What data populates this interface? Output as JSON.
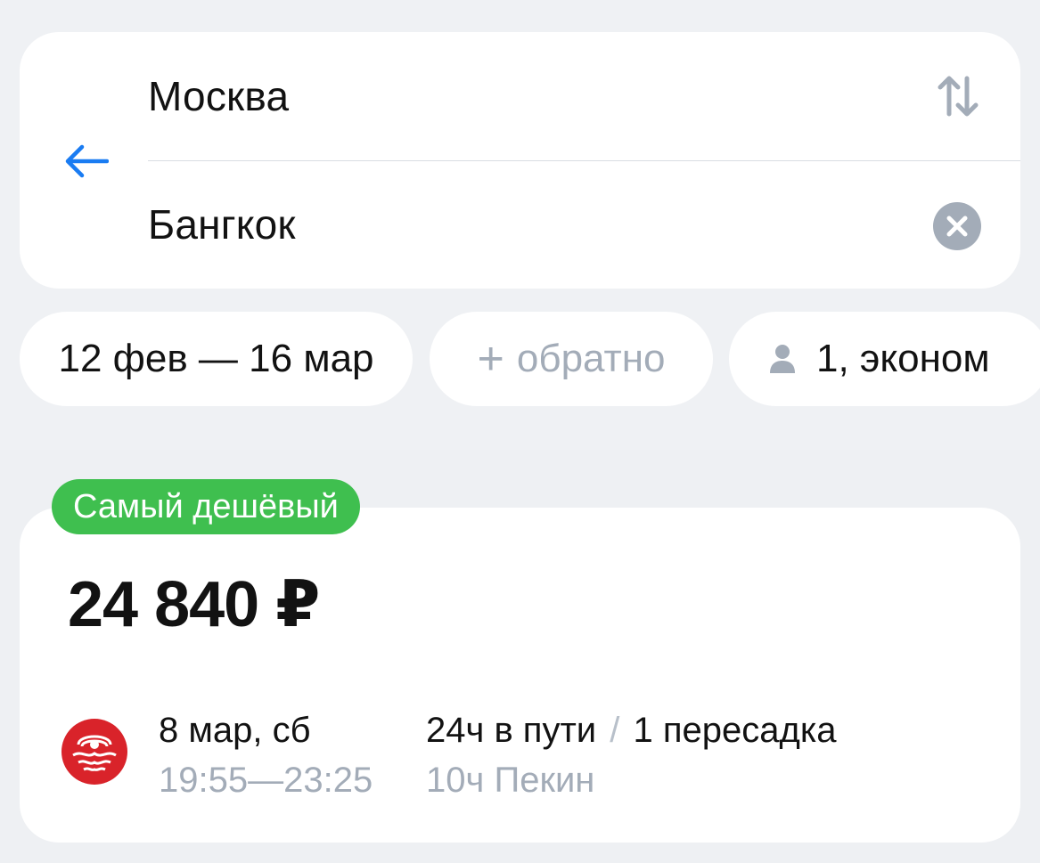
{
  "search": {
    "origin": "Москва",
    "destination": "Бангкок",
    "icons": {
      "back": "arrow-left-icon",
      "swap": "swap-vertical-icon",
      "clear": "clear-circle-icon"
    }
  },
  "filters": {
    "dates": "12 фев — 16 мар",
    "return_plus": "+",
    "return_label": "обратно",
    "passengers": "1, эконом",
    "passenger_icon": "person-icon"
  },
  "result": {
    "badge": "Самый дешёвый",
    "price": "24 840 ₽",
    "airline_logo": "airline-logo-icon",
    "date": "8 мар, сб",
    "times": "19:55—23:25",
    "duration": "24ч в пути",
    "separator": "/",
    "stops": "1 пересадка",
    "layover": "10ч Пекин"
  },
  "colors": {
    "accent": "#1a7cf2",
    "badge_green": "#3fbf4f",
    "muted": "#a3acb8",
    "background": "#eff1f4",
    "airline_red": "#d9232a"
  }
}
